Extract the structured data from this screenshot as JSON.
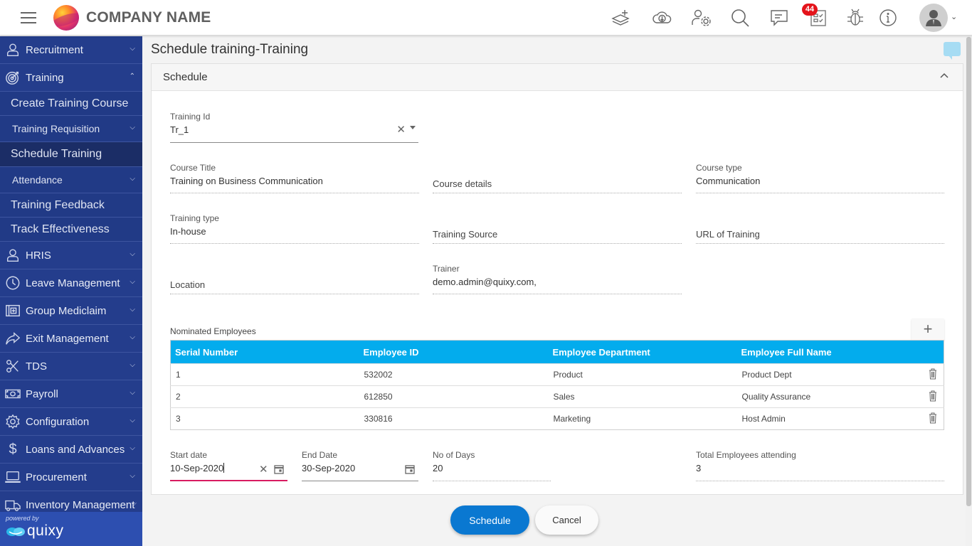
{
  "header": {
    "company_name": "COMPANY NAME",
    "notification_count": "44",
    "icons": [
      "add-layer-icon",
      "cloud-download-icon",
      "user-settings-icon",
      "search-icon",
      "chat-icon",
      "tasks-icon",
      "bug-icon",
      "info-icon"
    ]
  },
  "sidebar": {
    "items": [
      {
        "label": "Recruitment",
        "icon": "user-icon",
        "expanded": false
      },
      {
        "label": "Training",
        "icon": "target-icon",
        "expanded": true,
        "children": [
          {
            "label": "Create Training Course"
          },
          {
            "label": "Training Requisition",
            "has_children": true
          },
          {
            "label": "Schedule Training",
            "active": true
          },
          {
            "label": "Attendance",
            "has_children": true
          },
          {
            "label": "Training Feedback"
          },
          {
            "label": "Track Effectiveness"
          }
        ]
      },
      {
        "label": "HRIS",
        "icon": "user-icon"
      },
      {
        "label": "Leave Management",
        "icon": "clock-icon"
      },
      {
        "label": "Group Mediclaim",
        "icon": "medical-icon"
      },
      {
        "label": "Exit Management",
        "icon": "share-arrow-icon"
      },
      {
        "label": "TDS",
        "icon": "scissors-icon"
      },
      {
        "label": "Payroll",
        "icon": "money-icon"
      },
      {
        "label": "Configuration",
        "icon": "gear-icon"
      },
      {
        "label": "Loans and Advances",
        "icon": "dollar-icon"
      },
      {
        "label": "Procurement",
        "icon": "laptop-icon"
      },
      {
        "label": "Inventory Management",
        "icon": "truck-icon"
      }
    ],
    "powered_by": "powered by",
    "brand": "quixy"
  },
  "page": {
    "title": "Schedule training-Training",
    "section_title": "Schedule"
  },
  "form": {
    "training_id": {
      "label": "Training Id",
      "value": "Tr_1"
    },
    "course_title": {
      "label": "Course Title",
      "value": "Training on Business Communication"
    },
    "course_details": {
      "label": "Course details",
      "value": ""
    },
    "course_type": {
      "label": "Course type",
      "value": "Communication"
    },
    "training_type": {
      "label": "Training type",
      "value": "In-house"
    },
    "training_source": {
      "label": "Training Source",
      "value": ""
    },
    "url_of_training": {
      "label": "URL of Training",
      "value": ""
    },
    "location": {
      "label": "Location",
      "value": ""
    },
    "trainer": {
      "label": "Trainer",
      "value": "demo.admin@quixy.com,"
    },
    "start_date": {
      "label": "Start date",
      "value": "10-Sep-2020"
    },
    "end_date": {
      "label": "End Date",
      "value": "30-Sep-2020"
    },
    "no_of_days": {
      "label": "No of Days",
      "value": "20"
    },
    "total_employees": {
      "label": "Total Employees attending",
      "value": "3"
    }
  },
  "nominated": {
    "label": "Nominated Employees",
    "add_label": "+",
    "columns": [
      "Serial Number",
      "Employee ID",
      "Employee Department",
      "Employee Full Name"
    ],
    "rows": [
      [
        "1",
        "532002",
        "Product",
        "Product Dept"
      ],
      [
        "2",
        "612850",
        "Sales",
        "Quality Assurance"
      ],
      [
        "3",
        "330816",
        "Marketing",
        "Host Admin"
      ]
    ]
  },
  "actions": {
    "schedule": "Schedule",
    "cancel": "Cancel"
  },
  "colors": {
    "sidebar_bg": "#243d8c",
    "table_header": "#03aced",
    "primary_button": "#0a78d1",
    "focus_underline": "#d81b60",
    "badge": "#e4141b"
  }
}
